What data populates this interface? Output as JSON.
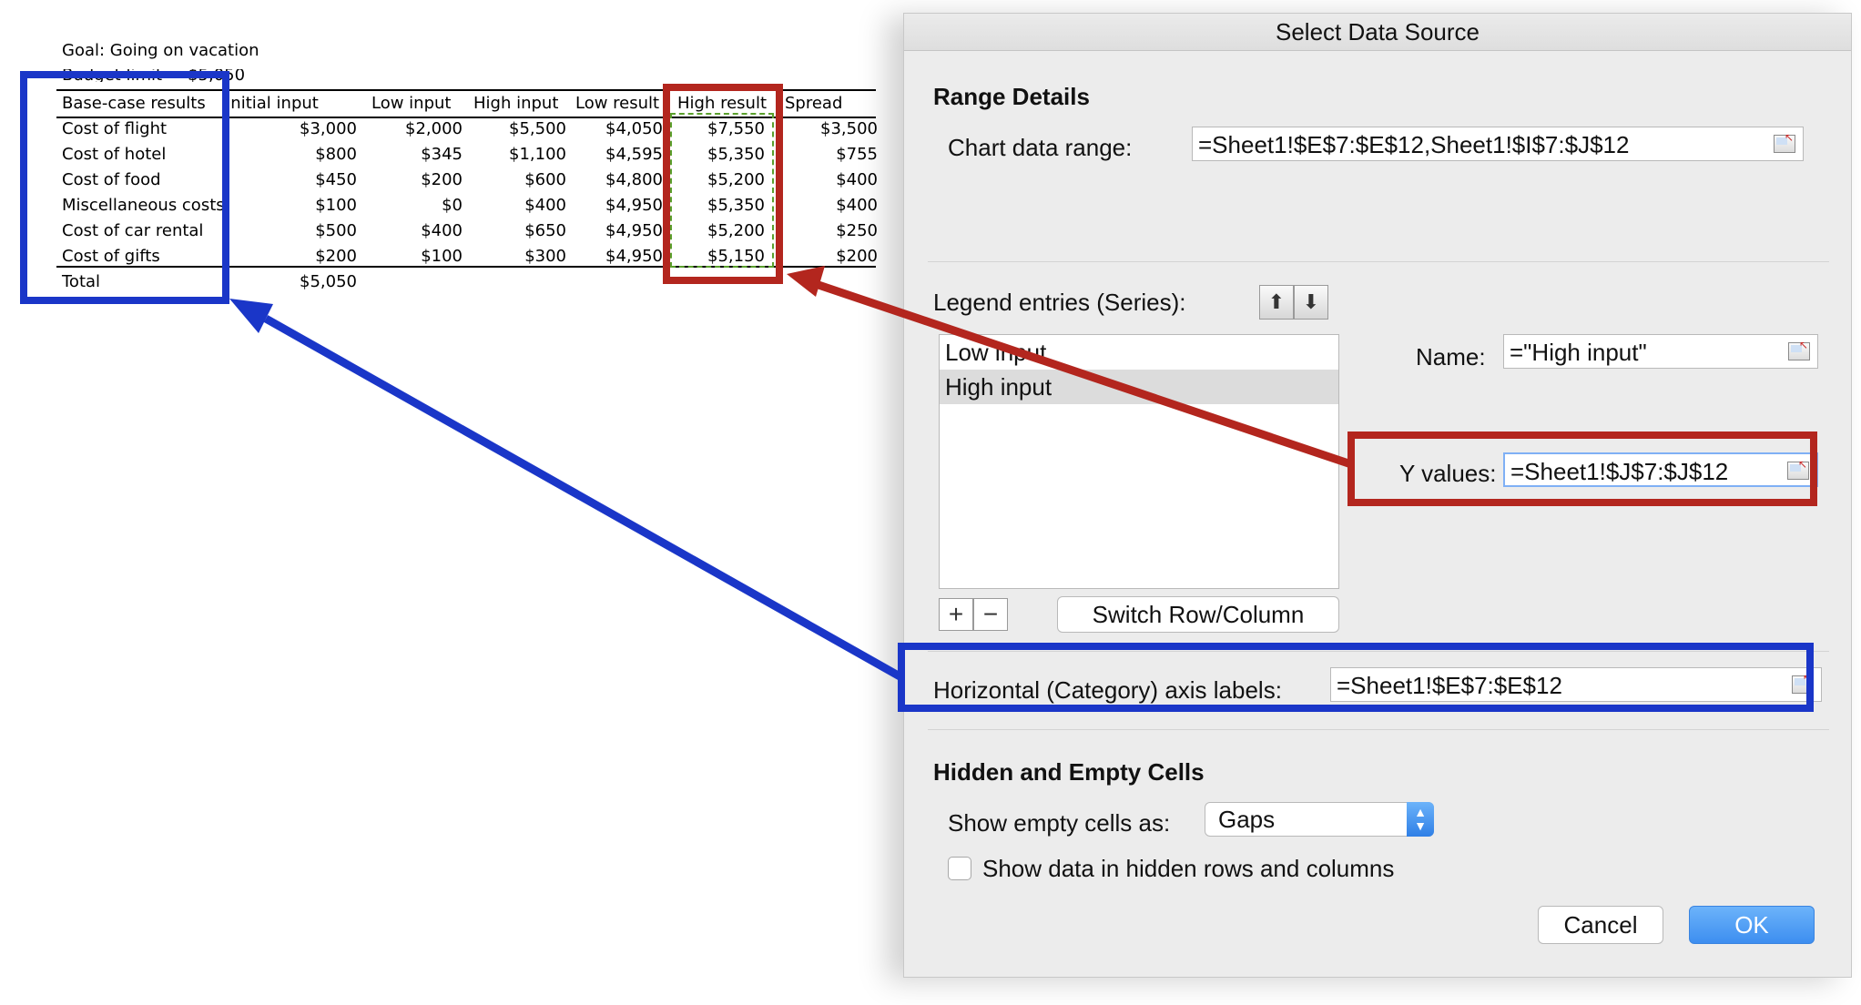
{
  "sheet": {
    "goal": "Goal: Going on vacation",
    "budget_label": "Budget limit",
    "budget_value": "$5,050",
    "headers": [
      "Base-case results",
      "Initial input",
      "Low input",
      "High input",
      "Low result",
      "High result",
      "Spread"
    ],
    "rows": [
      {
        "label": "Cost of flight",
        "initial": "$3,000",
        "low": "$2,000",
        "high": "$5,500",
        "low_result": "$4,050",
        "high_result": "$7,550",
        "spread": "$3,500"
      },
      {
        "label": "Cost of hotel",
        "initial": "$800",
        "low": "$345",
        "high": "$1,100",
        "low_result": "$4,595",
        "high_result": "$5,350",
        "spread": "$755"
      },
      {
        "label": "Cost of food",
        "initial": "$450",
        "low": "$200",
        "high": "$600",
        "low_result": "$4,800",
        "high_result": "$5,200",
        "spread": "$400"
      },
      {
        "label": "Miscellaneous costs",
        "initial": "$100",
        "low": "$0",
        "high": "$400",
        "low_result": "$4,950",
        "high_result": "$5,350",
        "spread": "$400"
      },
      {
        "label": "Cost of car rental",
        "initial": "$500",
        "low": "$400",
        "high": "$650",
        "low_result": "$4,950",
        "high_result": "$5,200",
        "spread": "$250"
      },
      {
        "label": "Cost of gifts",
        "initial": "$200",
        "low": "$100",
        "high": "$300",
        "low_result": "$4,950",
        "high_result": "$5,150",
        "spread": "$200"
      }
    ],
    "total_label": "Total",
    "total_value": "$5,050"
  },
  "dialog": {
    "title": "Select Data Source",
    "range_details_title": "Range Details",
    "chart_range_label": "Chart data range:",
    "chart_range_value": "=Sheet1!$E$7:$E$12,Sheet1!$I$7:$J$12",
    "legend_title": "Legend entries (Series):",
    "series": [
      "Low input",
      "High input"
    ],
    "selected_series": "High input",
    "name_label": "Name:",
    "name_value": "=\"High input\"",
    "y_values_label": "Y values:",
    "y_values_value": "=Sheet1!$J$7:$J$12",
    "plus_label": "+",
    "minus_label": "−",
    "switch_label": "Switch Row/Column",
    "axis_label": "Horizontal (Category) axis labels:",
    "axis_value": "=Sheet1!$E$7:$E$12",
    "hidden_title": "Hidden and Empty Cells",
    "empty_cells_label": "Show empty cells as:",
    "empty_cells_value": "Gaps",
    "hidden_rows_label": "Show data in hidden rows and columns",
    "hidden_rows_checked": false,
    "cancel_label": "Cancel",
    "ok_label": "OK"
  },
  "colors": {
    "annotation_blue": "#1a36c8",
    "annotation_red": "#b3261e",
    "ok_button": "#3d8ef0",
    "dashed_selection": "#5aa02c"
  },
  "icons": {
    "range_ref": "range-select-icon",
    "move_up": "arrow-up-icon",
    "move_down": "arrow-down-icon",
    "dropdown": "chevron-updown-icon"
  }
}
